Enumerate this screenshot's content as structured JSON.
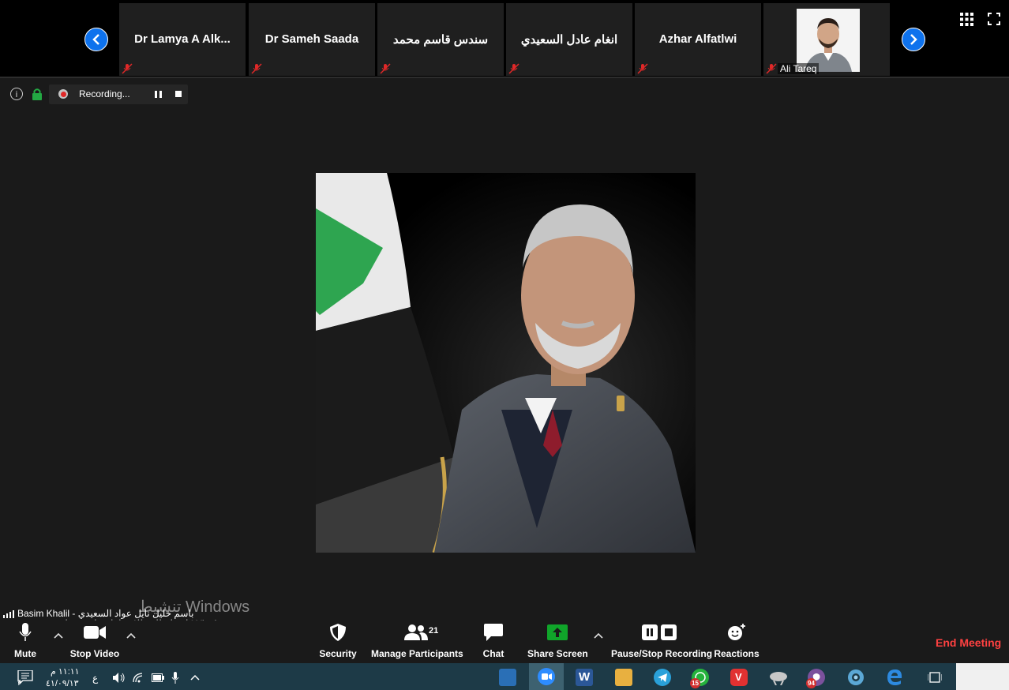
{
  "strip": {
    "participants": [
      {
        "name": "Dr Lamya A Alk..."
      },
      {
        "name": "Dr Sameh Saada"
      },
      {
        "name": "سندس قاسم محمد"
      },
      {
        "name": "انغام عادل السعيدي"
      },
      {
        "name": "Azhar Alfatlwi"
      },
      {
        "name": "Ali Tareq"
      }
    ]
  },
  "recording": {
    "label": "Recording..."
  },
  "speaker": {
    "name": "Basim Khalil - باسم خليل نايل عواد السعيدي"
  },
  "watermark": {
    "title": "تنشيط Windows",
    "subtitle": "انتقل إلى الإعدادات لتنشيط Windows."
  },
  "toolbar": {
    "mute": "Mute",
    "stop_video": "Stop Video",
    "security": "Security",
    "manage_participants": "Manage Participants",
    "participant_count": "21",
    "chat": "Chat",
    "share_screen": "Share Screen",
    "pause_stop_recording": "Pause/Stop Recording",
    "reactions": "Reactions",
    "end_meeting": "End Meeting"
  },
  "taskbar": {
    "time": "١١:١١ م",
    "date": "٤١/٠٩/١٣",
    "lang": "ع",
    "notif_count": "٣",
    "badge_whatsapp": "15",
    "badge_viber": "94"
  },
  "colors": {
    "accent": "#0e72ed",
    "end_meeting": "#ff4141",
    "share_green": "#10a52a",
    "taskbar": "#1d3a47"
  }
}
